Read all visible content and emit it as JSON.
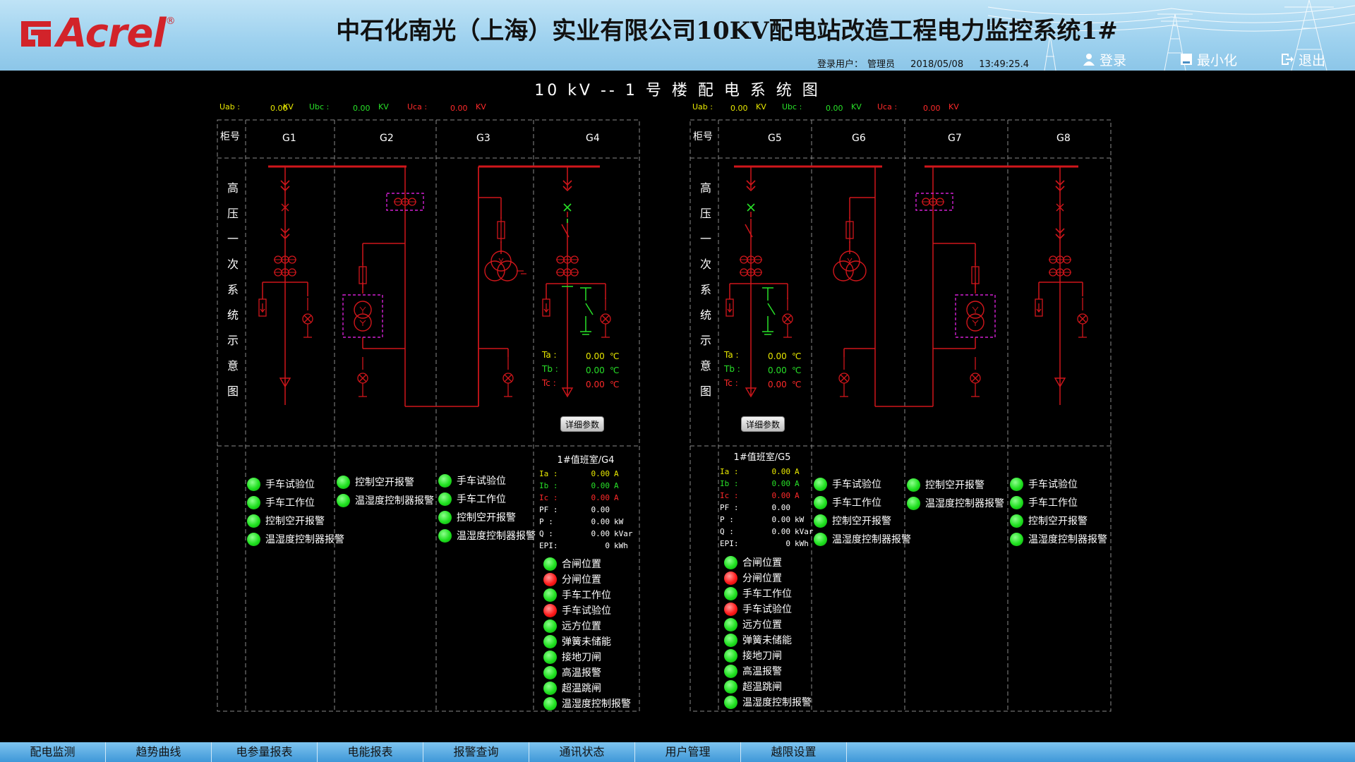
{
  "header": {
    "logo_text": "Acrel",
    "title": "中石化南光（上海）实业有限公司10KV配电站改造工程电力监控系统1#",
    "user_label": "登录用户：",
    "user_name": "管理员",
    "date": "2018/05/08",
    "time": "13:49:25.4",
    "login_label": "登录",
    "minimize_label": "最小化",
    "exit_label": "退出"
  },
  "diagram_title": "10 kV -- 1 号 楼 配 电 系 统 图",
  "colors": {
    "busbar": "#d0161b",
    "green": "#28e028",
    "yellow": "#e8e800",
    "magenta": "#d11fd1",
    "red_text": "#ff2a2a"
  },
  "sections": [
    {
      "voltage": {
        "uab_label": "Uab :",
        "uab": "0.00",
        "ubc_label": "Ubc :",
        "ubc": "0.00",
        "uca_label": "Uca :",
        "uca": "0.00",
        "unit": "KV"
      },
      "cabinet_header": "柜号",
      "side_label": [
        "高",
        "压",
        "一",
        "次",
        "系",
        "统",
        "示",
        "意",
        "图"
      ],
      "cabinets": [
        "G1",
        "G2",
        "G3",
        "G4"
      ],
      "temps": {
        "ta_label": "Ta :",
        "ta": "0.00",
        "tb_label": "Tb :",
        "tb": "0.00",
        "tc_label": "Tc :",
        "tc": "0.00",
        "unit": "℃"
      },
      "detail_button": "详细参数",
      "panel_caption": "1#值班室/G4",
      "measurements": [
        {
          "k": "Ia :",
          "v": "0.00",
          "u": "A",
          "color": "yellow"
        },
        {
          "k": "Ib :",
          "v": "0.00",
          "u": "A",
          "color": "green"
        },
        {
          "k": "Ic :",
          "v": "0.00",
          "u": "A",
          "color": "red"
        },
        {
          "k": "PF :",
          "v": "0.00",
          "u": "",
          "color": "white"
        },
        {
          "k": "P  :",
          "v": "0.00",
          "u": "kW",
          "color": "white"
        },
        {
          "k": "Q  :",
          "v": "0.00",
          "u": "kVar",
          "color": "white"
        },
        {
          "k": "EPI:",
          "v": "0",
          "u": "kWh",
          "color": "white"
        }
      ],
      "status_columns": [
        [
          {
            "label": "手车试验位",
            "state": "green"
          },
          {
            "label": "手车工作位",
            "state": "green"
          },
          {
            "label": "控制空开报警",
            "state": "green"
          },
          {
            "label": "温湿度控制器报警",
            "state": "green"
          }
        ],
        [
          {
            "label": "控制空开报警",
            "state": "green"
          },
          {
            "label": "温湿度控制器报警",
            "state": "green"
          }
        ],
        [
          {
            "label": "手车试验位",
            "state": "green"
          },
          {
            "label": "手车工作位",
            "state": "green"
          },
          {
            "label": "控制空开报警",
            "state": "green"
          },
          {
            "label": "温湿度控制器报警",
            "state": "green"
          }
        ],
        [
          {
            "label": "合闸位置",
            "state": "green"
          },
          {
            "label": "分闸位置",
            "state": "red"
          },
          {
            "label": "手车工作位",
            "state": "green"
          },
          {
            "label": "手车试验位",
            "state": "red"
          },
          {
            "label": "远方位置",
            "state": "green"
          },
          {
            "label": "弹簧未储能",
            "state": "green"
          },
          {
            "label": "接地刀闸",
            "state": "green"
          },
          {
            "label": "高温报警",
            "state": "green"
          },
          {
            "label": "超温跳闸",
            "state": "green"
          },
          {
            "label": "温湿度控制报警",
            "state": "green"
          }
        ]
      ]
    },
    {
      "voltage": {
        "uab_label": "Uab :",
        "uab": "0.00",
        "ubc_label": "Ubc :",
        "ubc": "0.00",
        "uca_label": "Uca :",
        "uca": "0.00",
        "unit": "KV"
      },
      "cabinet_header": "柜号",
      "side_label": [
        "高",
        "压",
        "一",
        "次",
        "系",
        "统",
        "示",
        "意",
        "图"
      ],
      "cabinets": [
        "G5",
        "G6",
        "G7",
        "G8"
      ],
      "temps": {
        "ta_label": "Ta :",
        "ta": "0.00",
        "tb_label": "Tb :",
        "tb": "0.00",
        "tc_label": "Tc :",
        "tc": "0.00",
        "unit": "℃"
      },
      "detail_button": "详细参数",
      "panel_caption": "1#值班室/G5",
      "measurements": [
        {
          "k": "Ia :",
          "v": "0.00",
          "u": "A",
          "color": "yellow"
        },
        {
          "k": "Ib :",
          "v": "0.00",
          "u": "A",
          "color": "green"
        },
        {
          "k": "Ic :",
          "v": "0.00",
          "u": "A",
          "color": "red"
        },
        {
          "k": "PF :",
          "v": "0.00",
          "u": "",
          "color": "white"
        },
        {
          "k": "P  :",
          "v": "0.00",
          "u": "kW",
          "color": "white"
        },
        {
          "k": "Q  :",
          "v": "0.00",
          "u": "kVar",
          "color": "white"
        },
        {
          "k": "EPI:",
          "v": "0",
          "u": "kWh",
          "color": "white"
        }
      ],
      "status_columns": [
        [
          {
            "label": "合闸位置",
            "state": "green"
          },
          {
            "label": "分闸位置",
            "state": "red"
          },
          {
            "label": "手车工作位",
            "state": "green"
          },
          {
            "label": "手车试验位",
            "state": "red"
          },
          {
            "label": "远方位置",
            "state": "green"
          },
          {
            "label": "弹簧未储能",
            "state": "green"
          },
          {
            "label": "接地刀闸",
            "state": "green"
          },
          {
            "label": "高温报警",
            "state": "green"
          },
          {
            "label": "超温跳闸",
            "state": "green"
          },
          {
            "label": "温湿度控制报警",
            "state": "green"
          }
        ],
        [
          {
            "label": "手车试验位",
            "state": "green"
          },
          {
            "label": "手车工作位",
            "state": "green"
          },
          {
            "label": "控制空开报警",
            "state": "green"
          },
          {
            "label": "温湿度控制器报警",
            "state": "green"
          }
        ],
        [
          {
            "label": "控制空开报警",
            "state": "green"
          },
          {
            "label": "温湿度控制器报警",
            "state": "green"
          }
        ],
        [
          {
            "label": "手车试验位",
            "state": "green"
          },
          {
            "label": "手车工作位",
            "state": "green"
          },
          {
            "label": "控制空开报警",
            "state": "green"
          },
          {
            "label": "温湿度控制器报警",
            "state": "green"
          }
        ]
      ]
    }
  ],
  "tabs": [
    "配电监测",
    "趋势曲线",
    "电参量报表",
    "电能报表",
    "报警查询",
    "通讯状态",
    "用户管理",
    "越限设置"
  ]
}
